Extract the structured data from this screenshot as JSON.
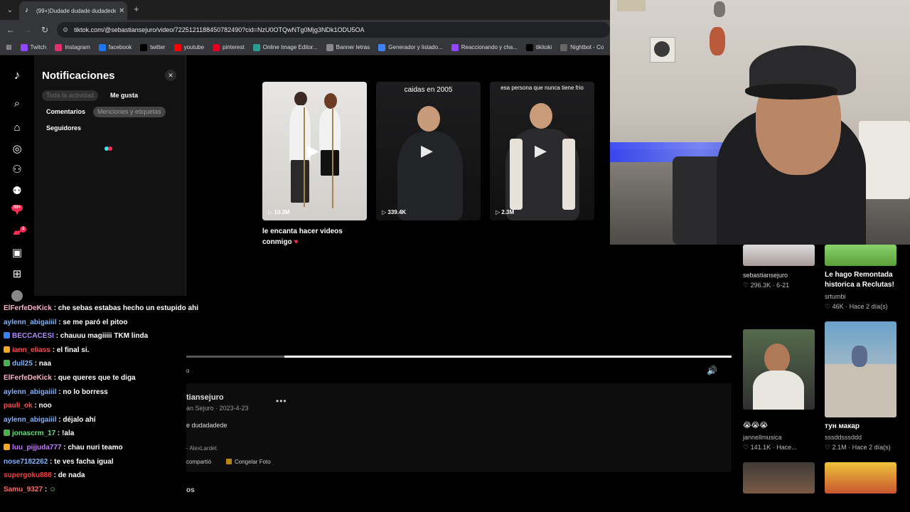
{
  "browser": {
    "tab_title": "(99+)Dudade dudade dudadede",
    "url": "tiktok.com/@sebastiansejuro/video/7225121188450782490?cid=NzU0OTQwNTg0Mjg3NDk1ODU5OA",
    "bookmarks": [
      {
        "label": "Twitch",
        "color": "#9146ff"
      },
      {
        "label": "Instagram",
        "color": "#e1306c"
      },
      {
        "label": "facebook",
        "color": "#1877f2"
      },
      {
        "label": "twitter",
        "color": "#000000"
      },
      {
        "label": "youtube",
        "color": "#ff0000"
      },
      {
        "label": "pinterest",
        "color": "#e60023"
      },
      {
        "label": "Online Image Editor...",
        "color": "#2a9d8f"
      },
      {
        "label": "Banner letras",
        "color": "#888888"
      },
      {
        "label": "Generador y listado...",
        "color": "#3b82f6"
      },
      {
        "label": "Reaccionando y cha...",
        "color": "#9146ff"
      },
      {
        "label": "tikitoki",
        "color": "#000000"
      },
      {
        "label": "Nightbot - Co",
        "color": "#666666"
      }
    ]
  },
  "rail": {
    "badge_notifications": "99+",
    "badge_messages": "2"
  },
  "notifications": {
    "title": "Notificaciones",
    "chips": {
      "all": "Toda la actividad",
      "likes": "Me gusta",
      "comments": "Comentarios",
      "mentions": "Menciones y etiquetas",
      "followers": "Seguidores"
    }
  },
  "videos": [
    {
      "caption": "",
      "views": "10.3M"
    },
    {
      "caption": "caidas en 2005",
      "views": "339.4K"
    },
    {
      "caption": "esa persona que nunca tiene frio",
      "views": "2.3M"
    }
  ],
  "description": {
    "text": "le encanta hacer videos conmigo",
    "emoji": "♥"
  },
  "player": {
    "time": "o",
    "user": "tiansejuro",
    "sub": "an Sejuro · 2023-4-23",
    "caption": "e dudadadede",
    "music": "- AlexLardet.",
    "shared": "compartió",
    "freeze": "Congelar Foto",
    "comments_tab": "os"
  },
  "chat": [
    {
      "user": "ElFerfeDeKick",
      "color": "#f8b4c6",
      "msg": "che sebas estabas hecho un estupido ahi",
      "badge": ""
    },
    {
      "user": "aylenn_abigaiiil",
      "color": "#7fb2ff",
      "msg": "se me paró el pitoo",
      "badge": ""
    },
    {
      "user": "BECCACESI",
      "color": "#b48cff",
      "msg": "chauuu magiiiii TKM linda",
      "badge": "#3b82f6"
    },
    {
      "user": "iann_eliass",
      "color": "#ff4d4d",
      "msg": "el final si.",
      "badge": "#f5a623"
    },
    {
      "user": "dull25",
      "color": "#7fb2ff",
      "msg": "naa",
      "badge": "#4caf50"
    },
    {
      "user": "ElFerfeDeKick",
      "color": "#f8b4c6",
      "msg": "que queres que te diga",
      "badge": ""
    },
    {
      "user": "aylenn_abigaiiil",
      "color": "#7fb2ff",
      "msg": "no lo borress",
      "badge": ""
    },
    {
      "user": "pauli_ok",
      "color": "#ff4d4d",
      "msg": "noo",
      "badge": ""
    },
    {
      "user": "aylenn_abigaiiil",
      "color": "#7fb2ff",
      "msg": "déjalo ahí",
      "badge": ""
    },
    {
      "user": "jonascrm_17",
      "color": "#5ee27a",
      "msg": "!ala",
      "badge": "#4caf50"
    },
    {
      "user": "luu_pijjuda777",
      "color": "#c17bff",
      "msg": "chau nuri teamo",
      "badge": "#f5a623"
    },
    {
      "user": "nose7182262",
      "color": "#7fb2ff",
      "msg": "te ves facha igual",
      "badge": ""
    },
    {
      "user": "supergoku888",
      "color": "#ff3b3b",
      "msg": "de nada",
      "badge": ""
    },
    {
      "user": "Samu_9327",
      "color": "#ff6b6b",
      "msg": "",
      "badge": ""
    }
  ],
  "right_grid": [
    {
      "title": "sebastiansejuro",
      "likes": "296.3K · 6-21",
      "sub": ""
    },
    {
      "title": "Le hago Remontada historica a Reclutas!",
      "sub": "srtumbi",
      "likes": "46K · Hace 2 día(s)"
    },
    {
      "title": "😭😭😭",
      "sub": "jannellmusica",
      "likes": "141.1K · Hace..."
    },
    {
      "title": "тун макар",
      "sub": "sssddsssddd",
      "likes": "2.1M · Hace 2 día(s)"
    }
  ]
}
